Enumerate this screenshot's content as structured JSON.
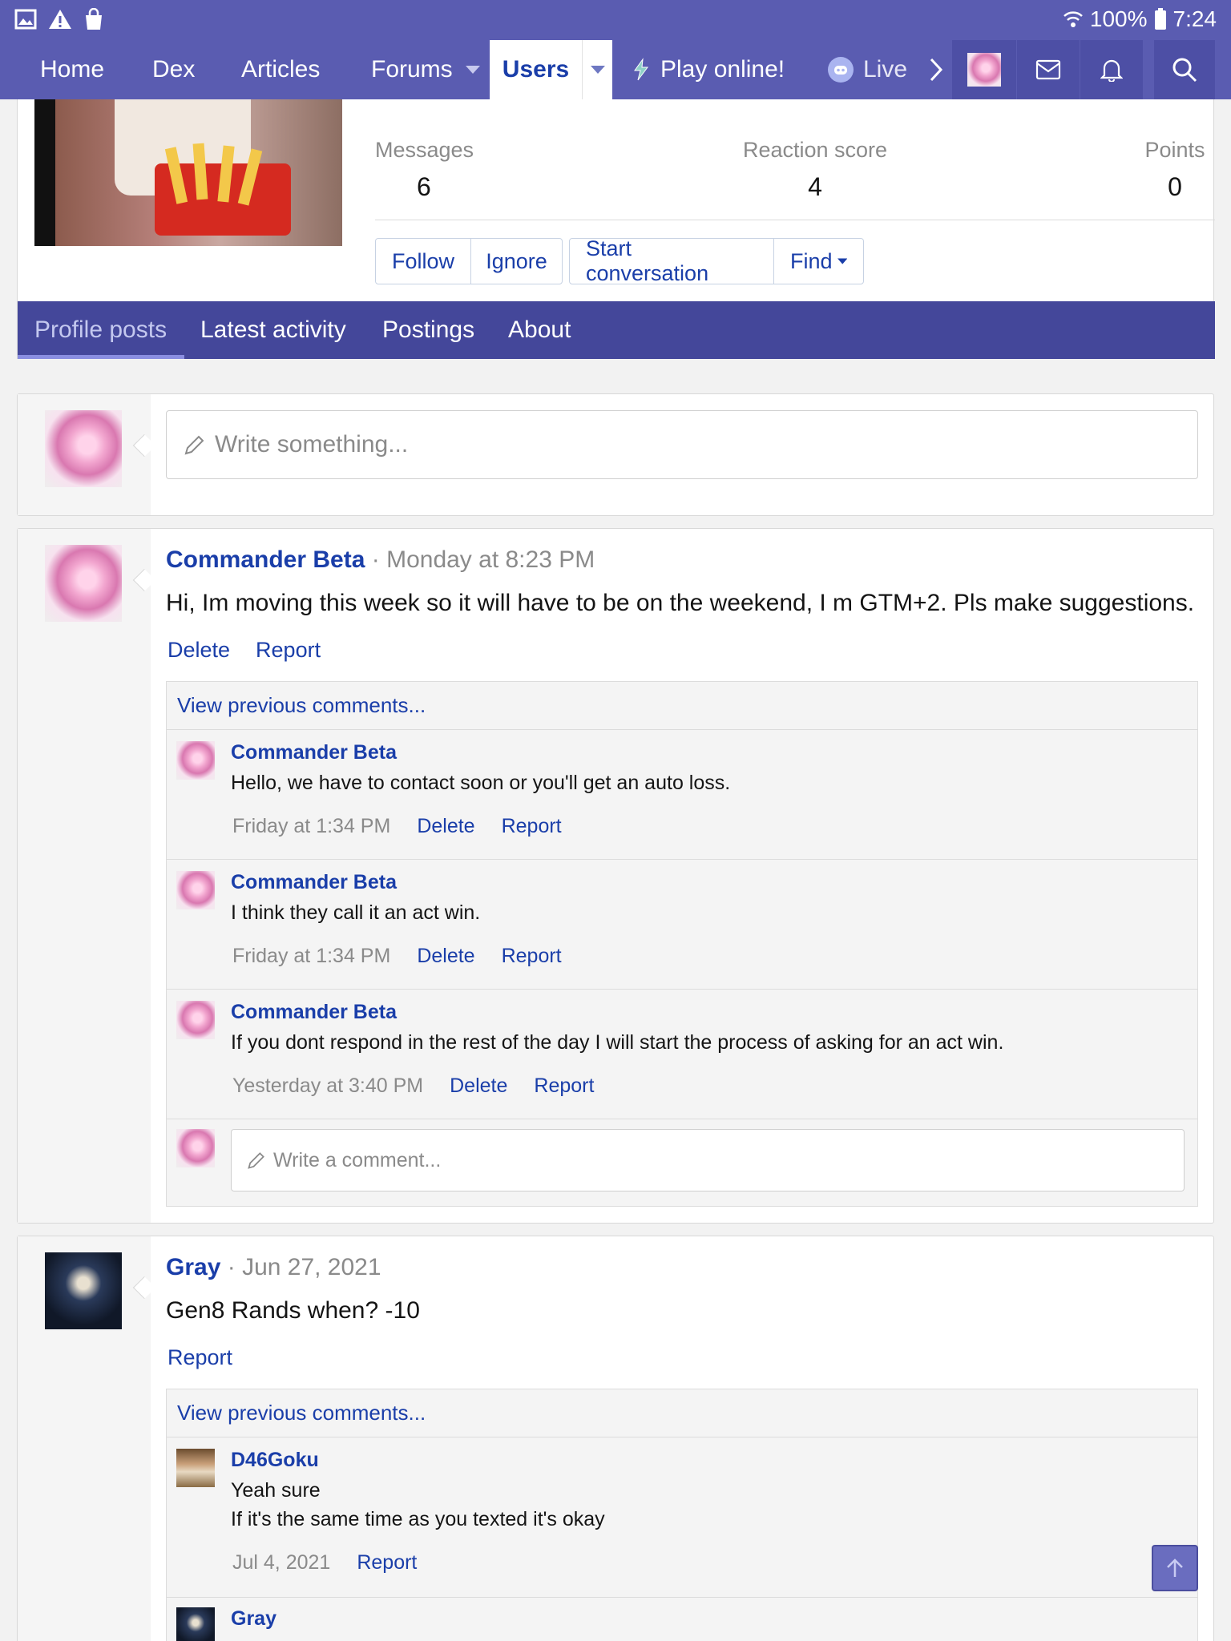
{
  "status_bar": {
    "battery": "100%",
    "time": "7:24"
  },
  "nav": {
    "items": [
      "Home",
      "Dex",
      "Articles",
      "Forums",
      "Users",
      "Play online!",
      "Live"
    ]
  },
  "profile": {
    "stats": [
      {
        "label": "Messages",
        "value": "6"
      },
      {
        "label": "Reaction score",
        "value": "4"
      },
      {
        "label": "Points",
        "value": "0"
      }
    ],
    "buttons": {
      "follow": "Follow",
      "ignore": "Ignore",
      "start_conversation": "Start conversation",
      "find": "Find"
    },
    "tabs": [
      "Profile posts",
      "Latest activity",
      "Postings",
      "About"
    ]
  },
  "composer": {
    "placeholder": "Write something..."
  },
  "posts": [
    {
      "author": "Commander Beta",
      "time": "Monday at 8:23 PM",
      "body": "Hi, Im moving this week so it will have to be on the weekend, I m GTM+2. Pls make suggestions.",
      "actions": [
        "Delete",
        "Report"
      ],
      "view_previous": "View previous comments...",
      "comments": [
        {
          "author": "Commander Beta",
          "text": "Hello, we have to contact soon or you'll get an auto loss.",
          "time": "Friday at 1:34 PM",
          "actions": [
            "Delete",
            "Report"
          ]
        },
        {
          "author": "Commander Beta",
          "text": "I think they call it an act win.",
          "time": "Friday at 1:34 PM",
          "actions": [
            "Delete",
            "Report"
          ]
        },
        {
          "author": "Commander Beta",
          "text": "If you dont respond in the rest of the day I will start the process of asking for an act win.",
          "time": "Yesterday at 3:40 PM",
          "actions": [
            "Delete",
            "Report"
          ]
        }
      ],
      "comment_placeholder": "Write a comment..."
    },
    {
      "author": "Gray",
      "time": "Jun 27, 2021",
      "body": "Gen8 Rands when? -10",
      "actions": [
        "Report"
      ],
      "view_previous": "View previous comments...",
      "comments": [
        {
          "author": "D46Goku",
          "text_lines": [
            "Yeah sure",
            "If it's the same time as you texted it's okay"
          ],
          "time": "Jul 4, 2021",
          "actions": [
            "Report"
          ]
        },
        {
          "author": "Gray"
        }
      ]
    }
  ]
}
